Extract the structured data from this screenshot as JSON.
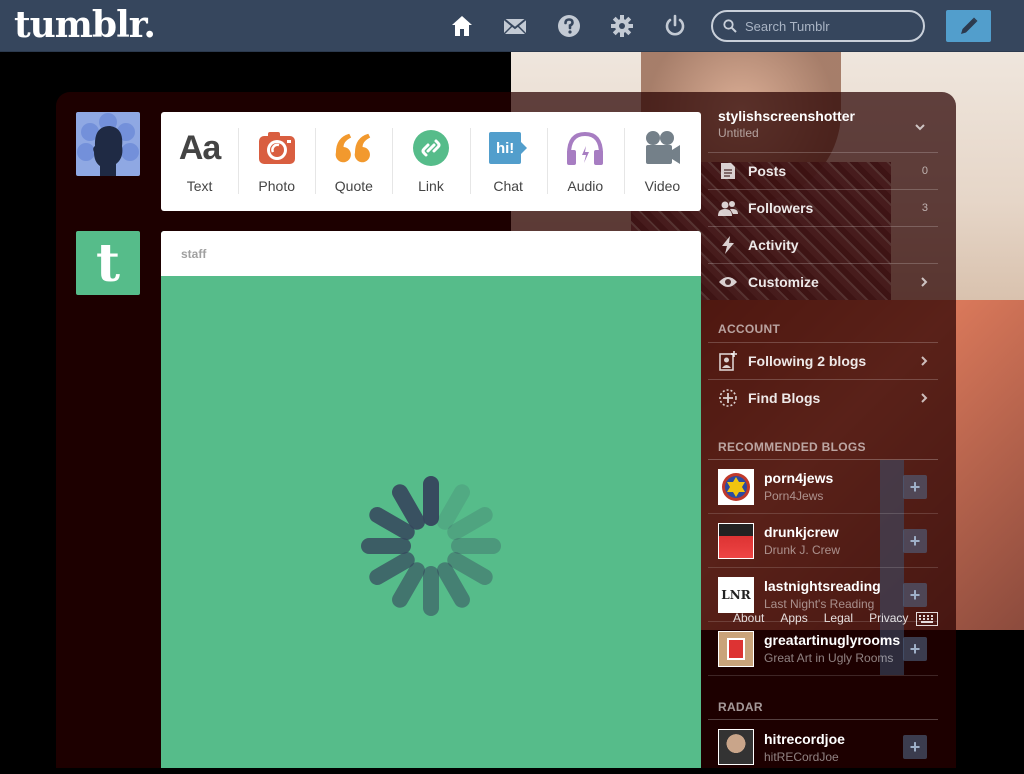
{
  "header": {
    "logo": "tumblr.",
    "search_placeholder": "Search Tumblr"
  },
  "post_types": [
    {
      "label": "Text",
      "icon": "text-icon",
      "color": "#444444"
    },
    {
      "label": "Photo",
      "icon": "camera-icon",
      "color": "#d95e40"
    },
    {
      "label": "Quote",
      "icon": "quote-icon",
      "color": "#f2992e"
    },
    {
      "label": "Link",
      "icon": "link-icon",
      "color": "#56bc8a"
    },
    {
      "label": "Chat",
      "icon": "chat-icon",
      "color": "#529ecc"
    },
    {
      "label": "Audio",
      "icon": "headphones-icon",
      "color": "#a77dc2"
    },
    {
      "label": "Video",
      "icon": "video-camera-icon",
      "color": "#748089"
    }
  ],
  "text_icon_glyph": "Aa",
  "chat_icon_glyph": "hi!",
  "staff_avatar_glyph": "t",
  "post": {
    "author": "staff",
    "bg_color": "#56bc8a"
  },
  "sidebar": {
    "blog_name": "stylishscreenshotter",
    "blog_title": "Untitled",
    "items": [
      {
        "label": "Posts",
        "count": "0"
      },
      {
        "label": "Followers",
        "count": "3"
      },
      {
        "label": "Activity"
      },
      {
        "label": "Customize"
      }
    ],
    "account_heading": "ACCOUNT",
    "account_items": [
      {
        "label": "Following 2 blogs"
      },
      {
        "label": "Find Blogs"
      }
    ],
    "recommended_heading": "RECOMMENDED BLOGS",
    "recommended": [
      {
        "name": "porn4jews",
        "title": "Porn4Jews"
      },
      {
        "name": "drunkjcrew",
        "title": "Drunk J. Crew"
      },
      {
        "name": "lastnightsreading",
        "title": "Last Night's Reading"
      },
      {
        "name": "greatartinuglyrooms",
        "title": "Great Art in Ugly Rooms"
      }
    ],
    "radar_heading": "RADAR",
    "radar": [
      {
        "name": "hitrecordjoe",
        "title": "hitRECordJoe"
      }
    ],
    "follow_glyph": "+"
  },
  "lnr_glyph": "LNR",
  "footer_links": [
    "About",
    "Apps",
    "Legal",
    "Privacy"
  ]
}
